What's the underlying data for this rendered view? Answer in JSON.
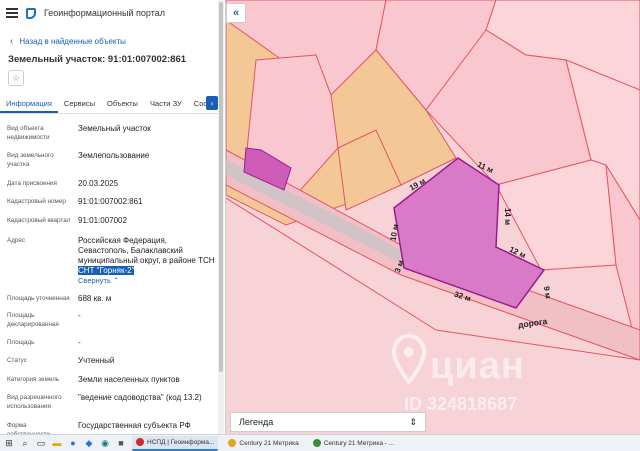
{
  "portal": {
    "title": "Геоинформационный портал"
  },
  "nav": {
    "back_label": "Назад в найденные объекты"
  },
  "parcel": {
    "title": "Земельный участок: 91:01:007002:861"
  },
  "tabs": [
    "Информация",
    "Сервисы",
    "Объекты",
    "Части ЗУ",
    "Соста"
  ],
  "properties": [
    {
      "label": "Вид объекта недвижимости",
      "value": "Земельный участок"
    },
    {
      "label": "Вид земельного участка",
      "value": "Землепользование"
    },
    {
      "label": "Дата присвоения",
      "value": "20.03.2025"
    },
    {
      "label": "Кадастровый номер",
      "value": "91:01:007002:861"
    },
    {
      "label": "Кадастровый квартал",
      "value": "91:01:007002"
    },
    {
      "label": "Адрес",
      "value": "Российская Федерация, Севастополь, Балаклавский муниципальный округ, в районе ТСН",
      "value_highlight": "СНТ \"Горняк-2\"",
      "link": "Свернуть"
    },
    {
      "label": "Площадь уточненная",
      "value": "688 кв. м"
    },
    {
      "label": "Площадь декларированная",
      "value": "-"
    },
    {
      "label": "Площадь",
      "value": "-"
    },
    {
      "label": "Статус",
      "value": "Учтенный"
    },
    {
      "label": "Категория земель",
      "value": "Земли населенных пунктов"
    },
    {
      "label": "Вид разрешенного использования",
      "value": "\"ведение садоводства\" (код 13.2)"
    },
    {
      "label": "Форма собственности",
      "value": "Государственная субъекта РФ"
    }
  ],
  "map": {
    "edge_labels": [
      "11 м",
      "19 м",
      "14 м",
      "10 м",
      "12 м",
      "3 м",
      "32 м",
      "9 м"
    ],
    "road_label": "дорога",
    "legend_label": "Легенда",
    "watermark": {
      "brand": "циан",
      "id": "ID 324818687"
    }
  },
  "taskbar": {
    "items": [
      {
        "label": "НСПД | Геоинформа...",
        "color": "#cc2b2b",
        "active": true
      },
      {
        "label": "Century 21 Метрика",
        "color": "#e5a323",
        "active": false
      },
      {
        "label": "Century 21 Метрика - ...",
        "color": "#3d8b3d",
        "active": false
      }
    ]
  },
  "colors": {
    "accent": "#1a5fb4",
    "parcel_fill": "#d97ac6",
    "parcel_stroke": "#a01890"
  }
}
